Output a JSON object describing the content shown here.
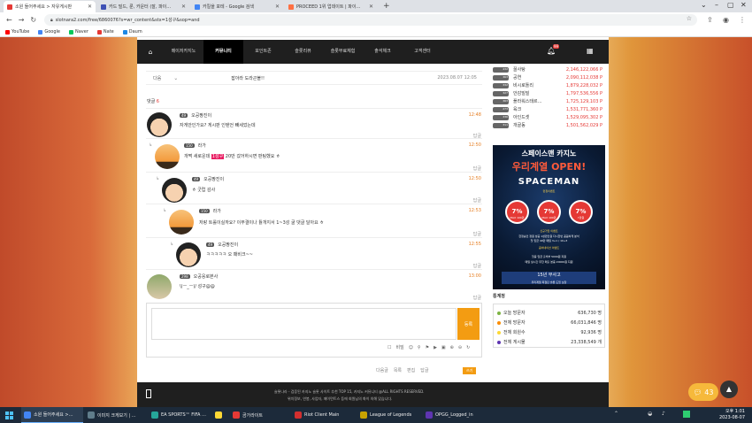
{
  "browser": {
    "tabs": [
      {
        "label": "소원 들어주세요 > 자유게시판",
        "color": "#e53935",
        "active": true
      },
      {
        "label": "카드 빌드, 룬, 카운터 (잘, 파이…",
        "color": "#3f51b5",
        "active": false
      },
      {
        "label": "카킬을 포테 - Google 검색",
        "color": "#4285f4",
        "active": false
      },
      {
        "label": "PROCEED 1위 업데이트 | 파이…",
        "color": "#ff7043",
        "active": false
      }
    ],
    "new_tab": "+",
    "url": "slotnara2.com/free/6860076?s=wr_content&stx=1성구&sop=and",
    "bookmarks": [
      {
        "label": "YouTube",
        "color": "#ff0000"
      },
      {
        "label": "Google",
        "color": "#4285f4"
      },
      {
        "label": "Naver",
        "color": "#03c75a"
      },
      {
        "label": "Nate",
        "color": "#e53935"
      },
      {
        "label": "Daum",
        "color": "#1e88e5"
      }
    ]
  },
  "site": {
    "nav": [
      "메이저카지노",
      "커뮤니티",
      "포인트존",
      "슬롯리뷰",
      "슬롯무료체험",
      "출석체크",
      "고객센터"
    ],
    "bell_badge": "99",
    "post": {
      "prev": "다음",
      "title": "잡아라 도라곤볼!!",
      "date": "2023.08.07 12:05"
    },
    "comment_label": "댓글",
    "comment_count": "6",
    "comments": [
      {
        "level": "49",
        "nick": "오공짱진이",
        "text": "자게안인가요? 게시판 인텐언 빼세었는데",
        "time": "12:48",
        "reply": "답글"
      },
      {
        "level": "150",
        "nick": "라가",
        "text_pre": "개쩍 새로운데",
        "highlight": "1성구",
        "text_post": "20만 갔어하시면 판팅했요 ㅎ",
        "time": "12:50",
        "reply": "답글"
      },
      {
        "level": "49",
        "nick": "오공짱진이",
        "text": "ㅎ 굿럽 감사",
        "time": "12:50",
        "reply": "답글"
      },
      {
        "level": "150",
        "nick": "라가",
        "text": "저랑 트롤이실까요? 이무결이나 튤개지서 1~3성 굴 댓글 달아요 ㅎ",
        "time": "12:53",
        "reply": "답글"
      },
      {
        "level": "49",
        "nick": "오공짱진이",
        "text": "ㅋㅋㅋㅋㅋ 오 패비크~~",
        "time": "12:55",
        "reply": "답글"
      },
      {
        "level": "298",
        "nick": "오공응로본사",
        "text": "\\(ㅡ_ㅡ)/ 성구@@",
        "time": "13:00",
        "reply": "답글"
      }
    ],
    "editor": {
      "placeholder": "",
      "submit": "등록",
      "secret": "비밀"
    },
    "actions": [
      "다음글",
      "목록",
      "편집",
      "답글"
    ],
    "list_btn": "쓰기",
    "ranking": [
      {
        "lv": "432",
        "name": "꿀사탕",
        "points": "2,146,122,066 P"
      },
      {
        "lv": "363",
        "name": "공연",
        "points": "2,090,112,038 P"
      },
      {
        "lv": "332",
        "name": "비시로톨리",
        "points": "1,879,228,032 P"
      },
      {
        "lv": "327",
        "name": "안감빌빌",
        "points": "1,797,536,556 P"
      },
      {
        "lv": "363",
        "name": "플라워스태르…",
        "points": "1,725,129,103 P"
      },
      {
        "lv": "273",
        "name": "육크",
        "points": "1,531,771,360 P"
      },
      {
        "lv": "336",
        "name": "아인드셋",
        "points": "1,529,095,302 P"
      },
      {
        "lv": "311",
        "name": "개골동",
        "points": "1,501,562,029 P"
      }
    ],
    "banner": {
      "line1": "스페이스맨 카지노",
      "line2": "우리계열 OPEN!",
      "line3": "SPACEMAN",
      "line4": "런칭이벤트",
      "c1p": "7%",
      "c1m": "MAX 100만",
      "c2p": "7%",
      "c2m": "MAX 100만",
      "c3p": "7%",
      "c3m": "7만원",
      "line5": "신규가입 이벤트",
      "line6": "한정승인 정원 성공 1성판인원 다시한번 꼼꼼하게 분석",
      "line7": "첫 입금 40만 매일 3+1 / 10+3",
      "line8": "콤비네이션 이벤트",
      "line9": "첫충 입금 출석부 5000원 지원",
      "line10": "매일 실시간 무한 매출 본충 20000원 지원",
      "line11": "15년 무사고",
      "line12": "우리계열 최첨단 슬롯 도입 보장"
    },
    "stats": {
      "title": "통계정",
      "rows": [
        {
          "label": "오늘 방문자",
          "value": "636,730 명",
          "color": "#7cb342"
        },
        {
          "label": "전체 방문자",
          "value": "66,031,846 명",
          "color": "#fb8c00"
        },
        {
          "label": "전체 회원수",
          "value": "92,936 명",
          "color": "#fdd835"
        },
        {
          "label": "전체 게시물",
          "value": "23,338,549 개",
          "color": "#5e35b1"
        }
      ]
    },
    "footer": {
      "line1": "슬롯나라 - 검증된 카지노 슬롯 사이트 추천 TOP 15, 카지노 커뮤니티 @ALL RIGHTS RESERVED.",
      "line2": "위치정보, 연봉, 사업자, 페이먼트스 등에 회원님의 화이 의해 있습니다."
    },
    "chat_count": "43"
  },
  "taskbar": {
    "items": [
      "소원 들어주세요 >…",
      "이미지 크게보기 | …",
      "EA SPORTS™ FIFA …",
      "",
      "곰가라이트",
      "Riot Client Main",
      "League of Legends",
      "OPGG_Logged_in"
    ],
    "time": "오후 1:01",
    "date": "2023-08-07"
  }
}
